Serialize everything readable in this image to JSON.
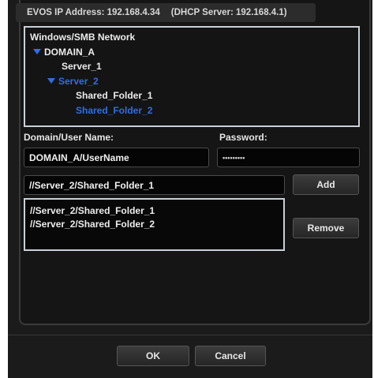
{
  "header": {
    "ip_text": "EVOS IP Address: 192.168.4.34",
    "dhcp_text": "(DHCP Server: 192.168.4.1)"
  },
  "tree": {
    "root": "Windows/SMB Network",
    "domain": "DOMAIN_A",
    "servers": [
      "Server_1",
      "Server_2"
    ],
    "folders": [
      "Shared_Folder_1",
      "Shared_Folder_2"
    ],
    "selected_color": "#2f6ee6"
  },
  "form": {
    "user_label": "Domain/User Name:",
    "password_label": "Password:",
    "user_value": "DOMAIN_A/UserName",
    "password_value": "•••••••••",
    "path_value": "//Server_2/Shared_Folder_1",
    "add_label": "Add",
    "remove_label": "Remove"
  },
  "shares": {
    "items": [
      "//Server_2/Shared_Folder_1",
      "//Server_2/Shared_Folder_2"
    ]
  },
  "footer": {
    "ok_label": "OK",
    "cancel_label": "Cancel"
  },
  "icons": {
    "expand": "triangle-down-icon"
  }
}
